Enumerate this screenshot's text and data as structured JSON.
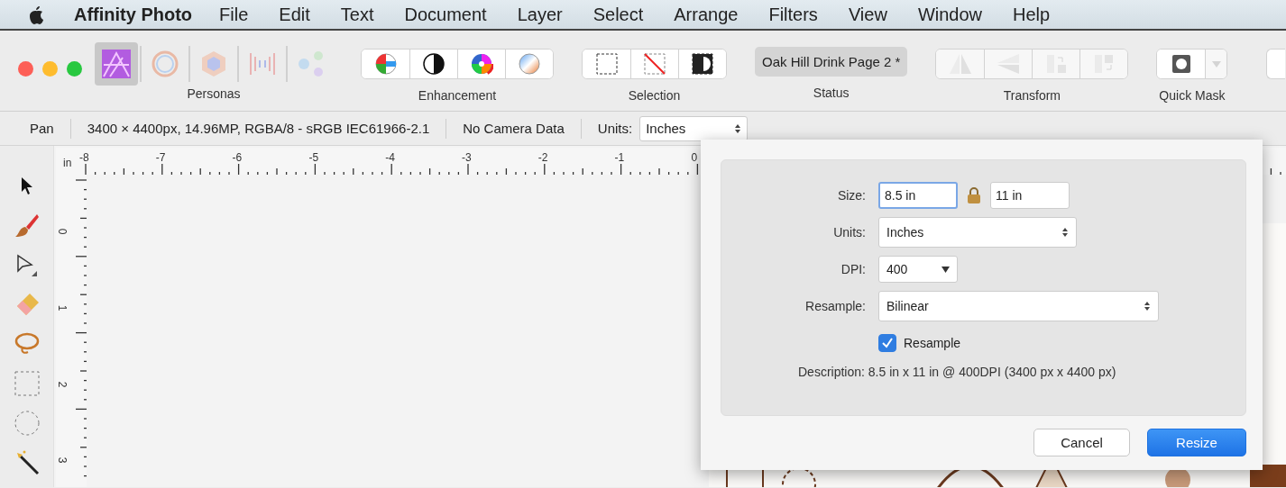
{
  "menu_bar": {
    "app_name": "Affinity Photo",
    "items": [
      "File",
      "Edit",
      "Text",
      "Document",
      "Layer",
      "Select",
      "Arrange",
      "Filters",
      "View",
      "Window",
      "Help"
    ]
  },
  "toolbar": {
    "groups": [
      {
        "kind": "personas",
        "label": "Personas",
        "buttons": [
          {
            "selected": true
          },
          {
            "selected": false
          },
          {
            "selected": false
          },
          {
            "selected": false
          },
          {
            "selected": false
          }
        ]
      },
      {
        "kind": "enhancement",
        "label": "Enhancement",
        "buttons": [
          {
            "disabled": false
          },
          {
            "disabled": false
          },
          {
            "disabled": false
          },
          {
            "disabled": false
          }
        ]
      },
      {
        "kind": "selection",
        "label": "Selection",
        "buttons": [
          {
            "disabled": false
          },
          {
            "disabled": false
          },
          {
            "disabled": false
          }
        ]
      },
      {
        "kind": "status",
        "label": "Status",
        "document": "Oak Hill Drink Page 2 *"
      },
      {
        "kind": "transform",
        "label": "Transform",
        "buttons": [
          {
            "disabled": true
          },
          {
            "disabled": true
          },
          {
            "disabled": true
          },
          {
            "disabled": true
          }
        ]
      },
      {
        "kind": "mask",
        "label": "Quick Mask",
        "buttons": [
          {
            "disabled": false
          },
          {
            "disabled": true
          }
        ]
      },
      {
        "kind": "partial"
      }
    ]
  },
  "context_bar": {
    "tool": "Pan",
    "info": "3400 × 4400px, 14.96MP, RGBA/8 - sRGB IEC61966-2.1",
    "camera": "No Camera Data",
    "units_label": "Units:",
    "units_value": "Inches"
  },
  "rulers": {
    "unit": "in",
    "top_labels": [
      "-8",
      "-7",
      "-6",
      "-5",
      "-4",
      "-3",
      "-2",
      "-1",
      "0"
    ],
    "left_labels": [
      "0",
      "1",
      "2",
      "3"
    ]
  },
  "dialog": {
    "rows": [
      {
        "kind": "size",
        "label": "Size:",
        "width": "8.5 in",
        "height": "11 in",
        "locked": true
      },
      {
        "kind": "stepper",
        "label": "Units:",
        "value": "Inches"
      },
      {
        "kind": "dropdown",
        "label": "DPI:",
        "value": "400"
      },
      {
        "kind": "wide-stepper",
        "label": "Resample:",
        "value": "Bilinear"
      },
      {
        "kind": "checkbox",
        "label": "Resample",
        "checked": true
      }
    ],
    "description": "Description: 8.5 in x 11 in @ 400DPI (3400 px x 4400 px)",
    "buttons": [
      {
        "label": "Cancel",
        "default": false
      },
      {
        "label": "Resize",
        "default": true
      }
    ]
  }
}
